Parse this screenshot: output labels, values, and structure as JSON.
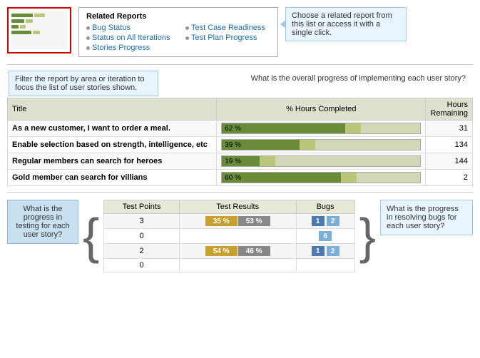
{
  "relatedReports": {
    "title": "Related Reports",
    "links": [
      {
        "label": "Bug Status",
        "col": 0
      },
      {
        "label": "Test Case Readiness",
        "col": 1
      },
      {
        "label": "Status on All Iterations",
        "col": 0
      },
      {
        "label": "Test Plan Progress",
        "col": 1
      },
      {
        "label": "Stories Progress",
        "col": 0
      }
    ]
  },
  "callouts": {
    "chooseReport": "Choose a related report from this list or access it with a single click.",
    "filterReport": "Filter the report by area or iteration to focus the list of user stories shown.",
    "overallProgress": "What is the overall progress of implementing each user story?",
    "testingProgress": "What is the progress in testing for each user story?",
    "bugsProgress": "What is the progress in resolving bugs for each user story?"
  },
  "mainTable": {
    "headers": [
      "Title",
      "% Hours Completed",
      "Hours Remaining"
    ],
    "rows": [
      {
        "title": "As a new customer, I want to order a meal.",
        "percent": 62,
        "remaining": 31
      },
      {
        "title": "Enable selection based on strength, intelligence, etc",
        "percent": 39,
        "remaining": 134
      },
      {
        "title": "Regular members can search for heroes",
        "percent": 19,
        "remaining": 144
      },
      {
        "title": "Gold member can search for villians",
        "percent": 60,
        "remaining": 2
      }
    ]
  },
  "bottomTable": {
    "headers": [
      "Test Points",
      "Test Results",
      "Bugs"
    ],
    "rows": [
      {
        "testPoints": 3,
        "passPercent": 35,
        "failPercent": 53,
        "bugActive": 1,
        "bugResolved": 2
      },
      {
        "testPoints": 0,
        "passPercent": null,
        "failPercent": null,
        "bugActive": null,
        "bugResolved": 6
      },
      {
        "testPoints": 2,
        "passPercent": 54,
        "failPercent": 46,
        "bugActive": 1,
        "bugResolved": 2
      },
      {
        "testPoints": 0,
        "passPercent": null,
        "failPercent": null,
        "bugActive": null,
        "bugResolved": null
      }
    ]
  },
  "colors": {
    "progressFill": "#6a8c3a",
    "progressRemaining": "#b8c878",
    "testPass": "#c8a030",
    "testFail": "#888888",
    "bugActive": "#4a7ab0",
    "bugResolved": "#7ab0d8",
    "calloutBg": "#e8f4ff",
    "calloutBorder": "#a0c8e8",
    "filterBg": "#e8f4ff",
    "testingBg": "#c8e0f0"
  }
}
